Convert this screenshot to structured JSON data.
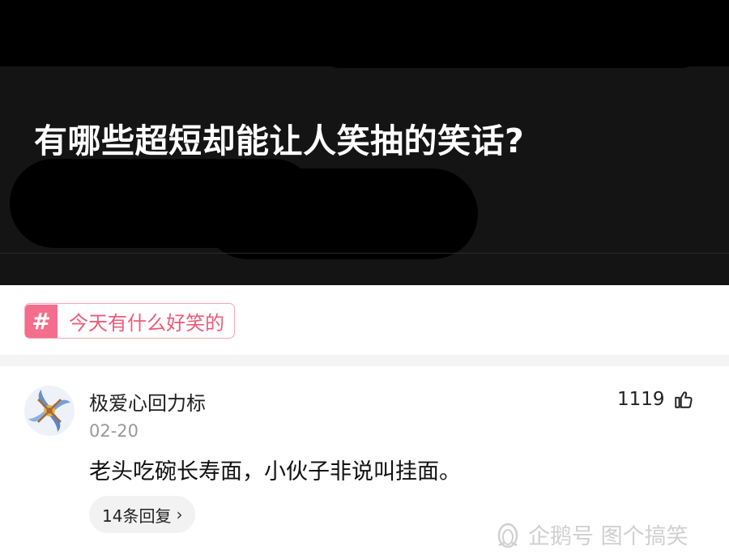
{
  "question": {
    "title": "有哪些超短却能让人笑抽的笑话?"
  },
  "topic": {
    "hash_symbol": "#",
    "label": "今天有什么好笑的"
  },
  "comment": {
    "username": "极爱心回力标",
    "date": "02-20",
    "likes": "1119",
    "content": "老头吃碗长寿面，小伙子非说叫挂面。",
    "replies_label": "14条回复",
    "replies_chevron": "›"
  },
  "watermark": {
    "text": "企鹅号 图个搞笑"
  },
  "icons": {
    "like": "thumbs-up-icon",
    "avatar": "pinwheel-avatar",
    "watermark": "penguin-icon"
  }
}
